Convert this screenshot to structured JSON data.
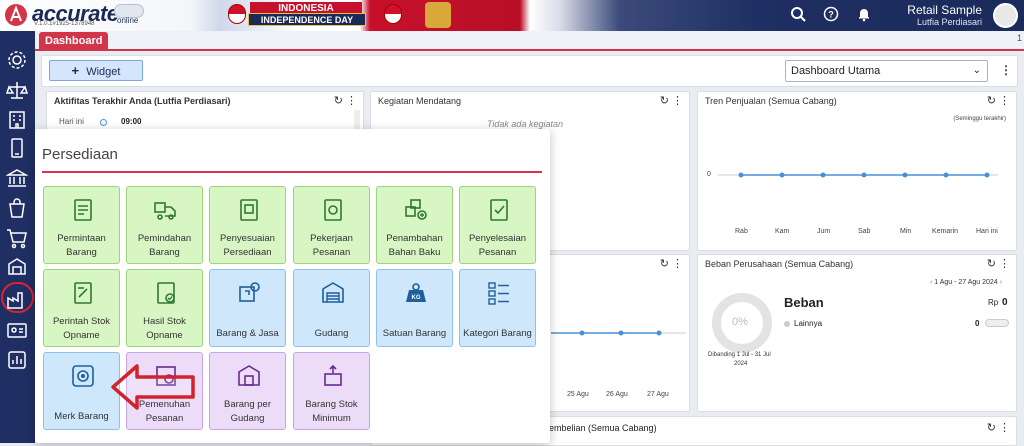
{
  "header": {
    "brand": "accurate",
    "brand_sub": "online",
    "version": "V.1.0.1#1925-1378948",
    "banner_title": "INDONESIA",
    "banner_sub": "INDEPENDENCE DAY",
    "user_name": "Retail Sample",
    "user_sub": "Lutfia Perdiasari",
    "icons": [
      "search-icon",
      "help-icon",
      "bell-icon"
    ]
  },
  "tabs": {
    "active": "Dashboard",
    "more": "1"
  },
  "toolbar": {
    "widget_label": "Widget",
    "dashboard_select": "Dashboard Utama"
  },
  "panels": {
    "activity": {
      "title": "Aktifitas Terakhir Anda (Lutfia Perdiasari)",
      "day": "Hari ini",
      "time": "09:00"
    },
    "upcoming": {
      "title": "Kegiatan Mendatang",
      "empty": "Tidak ada kegiatan"
    },
    "sales": {
      "title": "Tren Penjualan (Semua Cabang)",
      "period": "(Seminggu terakhir)",
      "zero": "0",
      "days": [
        "Rab",
        "Kam",
        "Jum",
        "Sab",
        "Min",
        "Kemarin",
        "Hari ini"
      ]
    },
    "middle": {
      "dates": [
        "25 Agu",
        "26 Agu",
        "27 Agu"
      ]
    },
    "expense": {
      "title": "Beban Perusahaan (Semua Cabang)",
      "range": "1 Agu - 27 Agu 2024",
      "percent": "0%",
      "compare": "Dibanding 1 Jul - 31 Jul",
      "compare_year": "2024",
      "label": "Beban",
      "currency": "Rp",
      "amount": "0",
      "other": "Lainnya",
      "other_amount": "0"
    },
    "purchase": {
      "title": "embelian (Semua Cabang)"
    }
  },
  "inventory_menu": {
    "title": "Persediaan",
    "tiles": [
      {
        "l1": "Permintaan",
        "l2": "Barang",
        "color": "g"
      },
      {
        "l1": "Pemindahan",
        "l2": "Barang",
        "color": "g"
      },
      {
        "l1": "Penyesuaian",
        "l2": "Persediaan",
        "color": "g"
      },
      {
        "l1": "Pekerjaan",
        "l2": "Pesanan",
        "color": "g"
      },
      {
        "l1": "Penambahan",
        "l2": "Bahan Baku",
        "color": "g"
      },
      {
        "l1": "Penyelesaian",
        "l2": "Pesanan",
        "color": "g"
      },
      {
        "l1": "Perintah Stok",
        "l2": "Opname",
        "color": "g"
      },
      {
        "l1": "Hasil Stok",
        "l2": "Opname",
        "color": "g"
      },
      {
        "l1": "Barang & Jasa",
        "l2": "",
        "color": "b"
      },
      {
        "l1": "Gudang",
        "l2": "",
        "color": "b"
      },
      {
        "l1": "Satuan Barang",
        "l2": "",
        "color": "b"
      },
      {
        "l1": "Kategori Barang",
        "l2": "",
        "color": "b"
      },
      {
        "l1": "Merk Barang",
        "l2": "",
        "color": "b"
      },
      {
        "l1": "Pemenuhan",
        "l2": "Pesanan",
        "color": "p"
      },
      {
        "l1": "Barang per",
        "l2": "Gudang",
        "color": "p"
      },
      {
        "l1": "Barang Stok",
        "l2": "Minimum",
        "color": "p"
      }
    ]
  },
  "sidebar": {
    "items": [
      "gear-icon",
      "scale-icon",
      "building-icon",
      "phone-icon",
      "bank-icon",
      "bag-icon",
      "cart-icon",
      "inventory-icon",
      "factory-icon",
      "id-card-icon",
      "chart-icon"
    ]
  }
}
